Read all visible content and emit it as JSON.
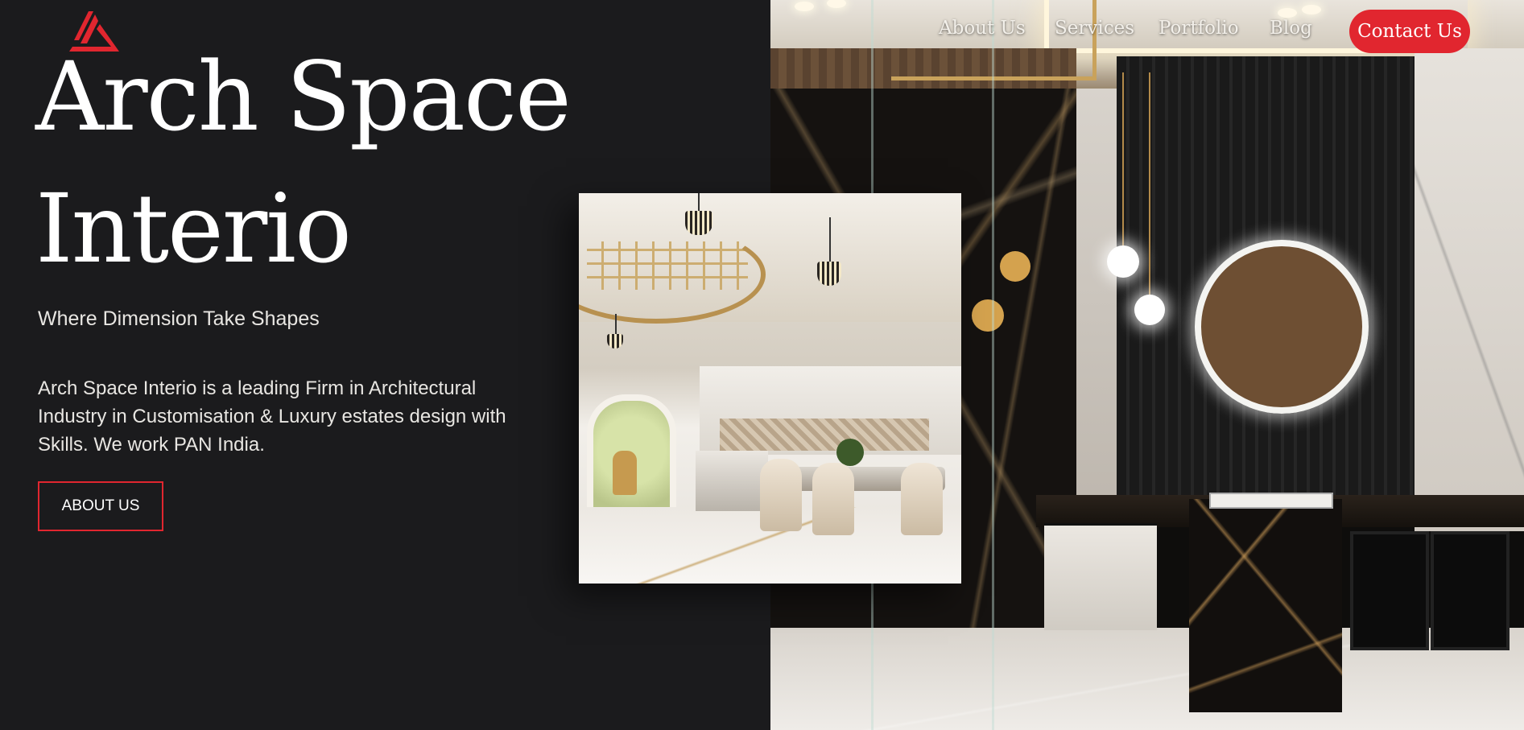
{
  "brand": {
    "logo_icon": "triangle-logo-icon",
    "accent_color": "#e1262f"
  },
  "nav": {
    "items": [
      {
        "label": "About Us"
      },
      {
        "label": "Services"
      },
      {
        "label": "Portfolio"
      },
      {
        "label": "Blog"
      }
    ],
    "contact_label": "Contact Us"
  },
  "hero": {
    "title_line1": "Arch Space",
    "title_line2": "Interio",
    "tagline": "Where Dimension Take Shapes",
    "description": "Arch Space Interio is a leading Firm in Architectural Industry in Customisation & Luxury estates design with Skills. We work PAN India.",
    "cta_label": "ABOUT US"
  },
  "colors": {
    "background": "#1b1b1d",
    "text": "#ffffff"
  }
}
